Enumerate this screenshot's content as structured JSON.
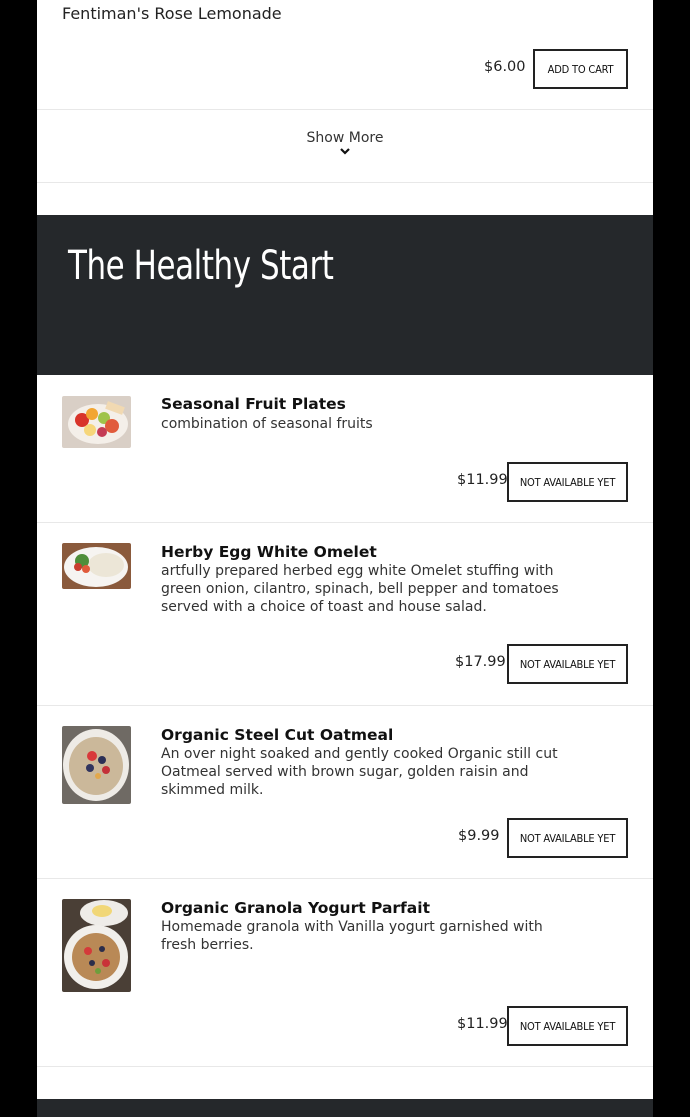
{
  "top_item": {
    "name": "Fentiman's Rose Lemonade",
    "price": "$6.00",
    "button": "Add to cart"
  },
  "show_more": {
    "label": "Show More"
  },
  "section": {
    "title": "The Healthy Start"
  },
  "items": [
    {
      "title": "Seasonal Fruit Plates",
      "desc": "combination of seasonal fruits",
      "price": "$11.99",
      "button": "Not available yet",
      "image_icon": "fruit-plate-photo"
    },
    {
      "title": "Herby Egg White Omelet",
      "desc": "artfully prepared herbed egg white Omelet stuffing with green onion, cilantro, spinach, bell pepper and tomatoes served with a choice of toast and house salad.",
      "price": "$17.99",
      "button": "Not available yet",
      "image_icon": "omelet-photo"
    },
    {
      "title": "Organic Steel Cut Oatmeal",
      "desc": "An over night soaked and gently cooked Organic still cut Oatmeal served with brown sugar, golden raisin and skimmed milk.",
      "price": "$9.99",
      "button": "Not available yet",
      "image_icon": "oatmeal-photo"
    },
    {
      "title": "Organic Granola Yogurt Parfait",
      "desc": "Homemade granola with Vanilla yogurt garnished with fresh berries.",
      "price": "$11.99",
      "button": "Not available yet",
      "image_icon": "granola-parfait-photo"
    }
  ]
}
